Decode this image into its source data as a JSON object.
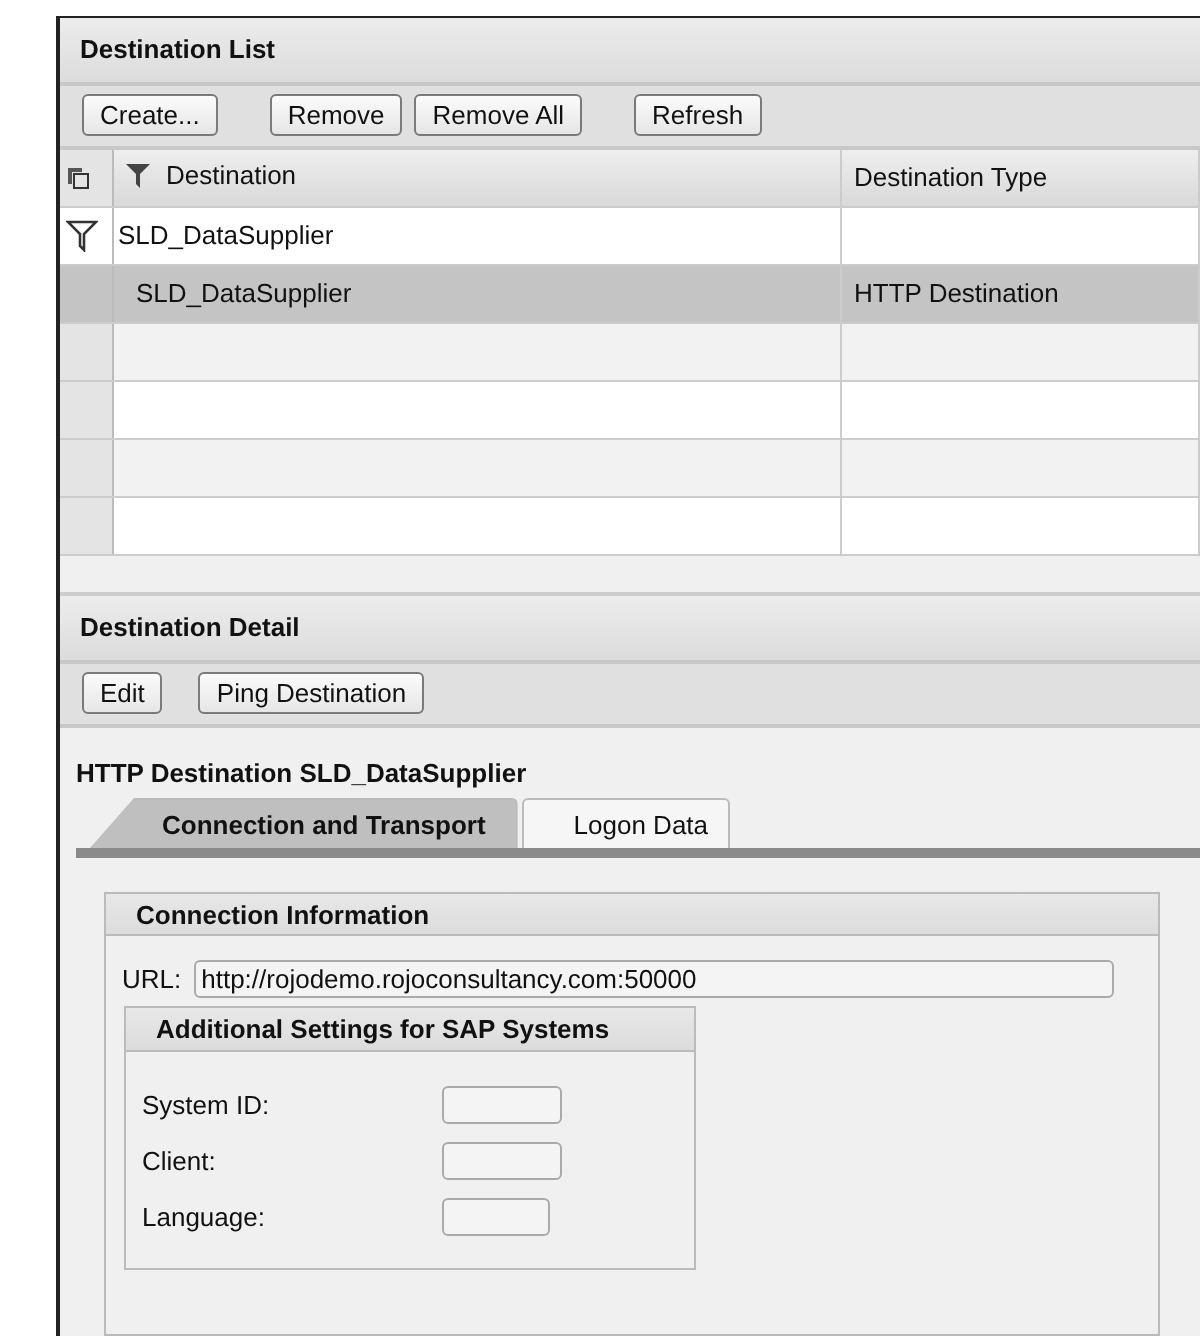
{
  "destination_list": {
    "title": "Destination List",
    "buttons": [
      "Create...",
      "Remove",
      "Remove All",
      "Refresh"
    ],
    "table": {
      "columns": [
        "Destination",
        "Destination Type"
      ],
      "filter": "SLD_DataSupplier",
      "rows": [
        {
          "destination": "SLD_DataSupplier",
          "type": "HTTP Destination",
          "selected": true
        }
      ]
    }
  },
  "destination_detail": {
    "title": "Destination Detail",
    "buttons": [
      "Edit",
      "Ping Destination"
    ],
    "heading": "HTTP Destination SLD_DataSupplier",
    "tabs": [
      {
        "label": "Connection and Transport",
        "selected": true
      },
      {
        "label": "Logon Data",
        "selected": false
      }
    ],
    "connection": {
      "title": "Connection Information",
      "url_label": "URL:",
      "url": "http://rojodemo.rojoconsultancy.com:50000",
      "sap_settings": {
        "title": "Additional Settings for SAP Systems",
        "fields": [
          {
            "label": "System ID:"
          },
          {
            "label": "Client:"
          },
          {
            "label": "Language:"
          }
        ]
      }
    }
  }
}
